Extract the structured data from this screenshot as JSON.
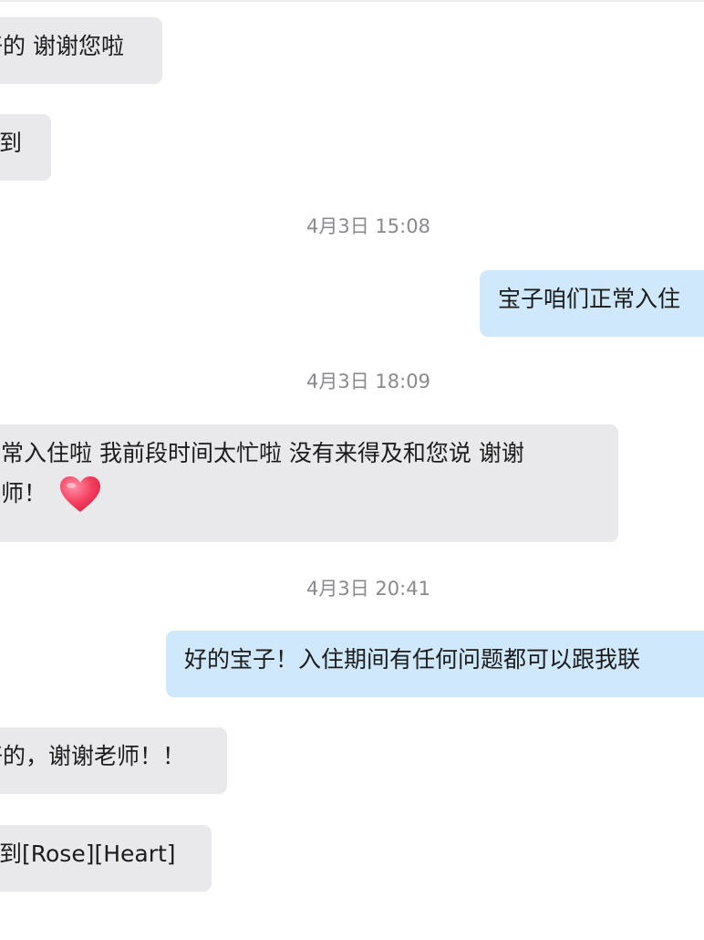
{
  "conversation": [
    {
      "kind": "in",
      "lines": [
        "好的 谢谢您啦"
      ]
    },
    {
      "kind": "in",
      "lines": [
        "收到"
      ]
    },
    {
      "kind": "time",
      "text": "4月3日 15:08"
    },
    {
      "kind": "out",
      "lines": [
        "宝子咱们正常入住"
      ]
    },
    {
      "kind": "time",
      "text": "4月3日 18:09"
    },
    {
      "kind": "in",
      "lines": [
        "正常入住啦 我前段时间太忙啦 没有来得及和您说 谢谢",
        "老师！"
      ],
      "emoji": "heart-icon"
    },
    {
      "kind": "time",
      "text": "4月3日 20:41"
    },
    {
      "kind": "out",
      "lines": [
        "好的宝子！入住期间有任何问题都可以跟我联"
      ]
    },
    {
      "kind": "in",
      "lines": [
        "好的，谢谢老师！！"
      ]
    },
    {
      "kind": "in",
      "lines": [
        "收到[Rose][Heart]"
      ]
    }
  ],
  "colors": {
    "incoming_bubble": "#e9e9eb",
    "outgoing_bubble": "#cfe8fb",
    "timestamp_text": "#8a8a8e",
    "message_text": "#1c1c1c"
  }
}
